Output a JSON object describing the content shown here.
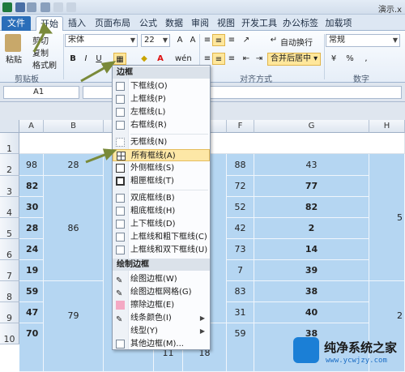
{
  "window": {
    "title": "演示.x"
  },
  "tabs": [
    "文件",
    "开始",
    "插入",
    "页面布局",
    "公式",
    "数据",
    "审阅",
    "视图",
    "开发工具",
    "办公标签",
    "加载项"
  ],
  "ribbon": {
    "clipboard": {
      "paste": "粘贴",
      "cut": "剪切",
      "copy": "复制",
      "format_painter": "格式刷",
      "group_label": "剪贴板"
    },
    "font": {
      "name": "宋体",
      "size": "22",
      "bold": "B",
      "italic": "I",
      "underline": "U",
      "wen": "wén"
    },
    "alignment": {
      "wrap": "自动换行",
      "merge": "合并后居中",
      "group_label": "对齐方式"
    },
    "number": {
      "format": "常规",
      "group_label": "数字"
    }
  },
  "formula_bar": {
    "name_box": "A1"
  },
  "columns": [
    "A",
    "B",
    "C",
    "D",
    "E",
    "F",
    "G",
    "H"
  ],
  "rows": [
    "1",
    "2",
    "3",
    "4",
    "5",
    "6",
    "7",
    "8",
    "9",
    "10"
  ],
  "cells": {
    "a": [
      "98",
      "82",
      "30",
      "28",
      "24",
      "19",
      "59",
      "47",
      "70"
    ],
    "b_merged": [
      "28",
      "86",
      "79"
    ],
    "f": [
      "88",
      "72",
      "52",
      "42",
      "73",
      "7",
      "83",
      "31",
      "59"
    ],
    "g": [
      "43",
      "77",
      "82",
      "2",
      "14",
      "39",
      "38",
      "40",
      "38"
    ],
    "h_partial": [
      "5",
      "2"
    ],
    "row10": {
      "d": "11",
      "e": "18"
    }
  },
  "border_menu": {
    "header": "边框",
    "items": [
      "下框线(O)",
      "上框线(P)",
      "左框线(L)",
      "右框线(R)",
      "无框线(N)",
      "所有框线(A)",
      "外侧框线(S)",
      "粗匣框线(T)",
      "双底框线(B)",
      "粗底框线(H)",
      "上下框线(D)",
      "上框线和粗下框线(C)",
      "上框线和双下框线(U)"
    ],
    "draw_header": "绘制边框",
    "draw_items": [
      "绘图边框(W)",
      "绘图边框网格(G)",
      "擦除边框(E)",
      "线条颜色(I)",
      "线型(Y)",
      "其他边框(M)..."
    ],
    "highlighted": "所有框线(A)"
  },
  "watermark": {
    "title": "纯净系统之家",
    "url": "www.ycwjzy.com"
  },
  "colors": {
    "file_tab": "#2a6eb9",
    "selection_fill": "#b5d6f2",
    "menu_highlight": "#fde7a6",
    "arrow": "#7a8a3a"
  }
}
